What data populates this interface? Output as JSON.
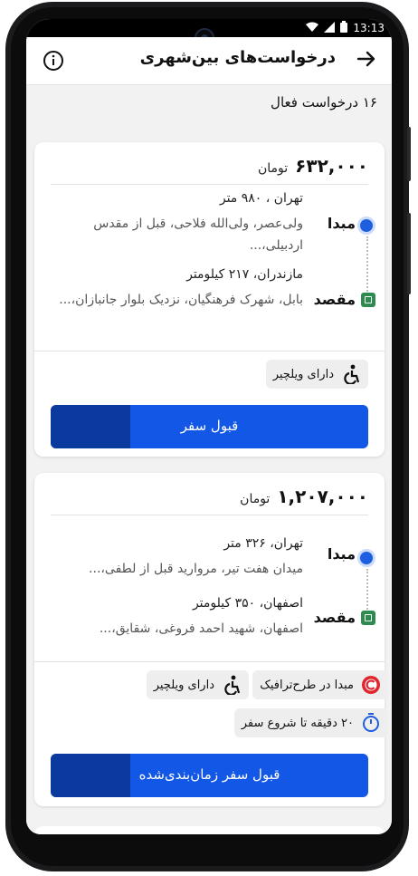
{
  "status_bar": {
    "time": "13:13",
    "icons": [
      "wifi-icon",
      "signal-icon",
      "battery-icon"
    ]
  },
  "header": {
    "title": "درخواست‌های بین‌شهری",
    "back_icon": "arrow-right-icon",
    "info_icon": "info-icon"
  },
  "active_count": "۱۶ درخواست فعال",
  "colors": {
    "primary": "#1257e6",
    "primary_dark": "#0b3a9e",
    "destination": "#2e8b4f",
    "traffic": "#e0262f"
  },
  "requests": [
    {
      "price": "۶۳۲,۰۰۰",
      "currency": "تومان",
      "origin": {
        "label": "مبدا",
        "line1": "تهران ، ۹۸۰ متر",
        "line2": "ولی‌عصر، ولی‌الله فلاحی، قبل از مقدس اردبیلی،..."
      },
      "destination": {
        "label": "مقصد",
        "line1": "مازندران، ۲۱۷ کیلومتر",
        "line2": "بابل، شهرک فرهنگیان، نزدیک بلوار جانبازان،..."
      },
      "tags": [
        {
          "label": "دارای ویلچیر",
          "icon": "wheelchair-icon"
        }
      ],
      "accept": {
        "label": "قبول سفر",
        "progress": 0.25
      }
    },
    {
      "price": "۱,۲۰۷,۰۰۰",
      "currency": "تومان",
      "origin": {
        "label": "مبدا",
        "line1": "تهران، ۳۲۶ متر",
        "line2": "میدان هفت تیر، مروارید قبل از لطفی،..."
      },
      "destination": {
        "label": "مقصد",
        "line1": "اصفهان، ۳۵۰ کیلومتر",
        "line2": "اصفهان، شهید احمد فروغی، شقایق،..."
      },
      "tags": [
        {
          "label": "مبدا در طرح‌ترافیک",
          "icon": "traffic-zone-icon"
        },
        {
          "label": "دارای ویلچیر",
          "icon": "wheelchair-icon"
        },
        {
          "label": "۲۰ دقیقه تا شروع سفر",
          "icon": "stopwatch-icon"
        }
      ],
      "accept": {
        "label": "قبول سفر زمان‌بندی‌شده",
        "progress": 0.25
      }
    }
  ]
}
